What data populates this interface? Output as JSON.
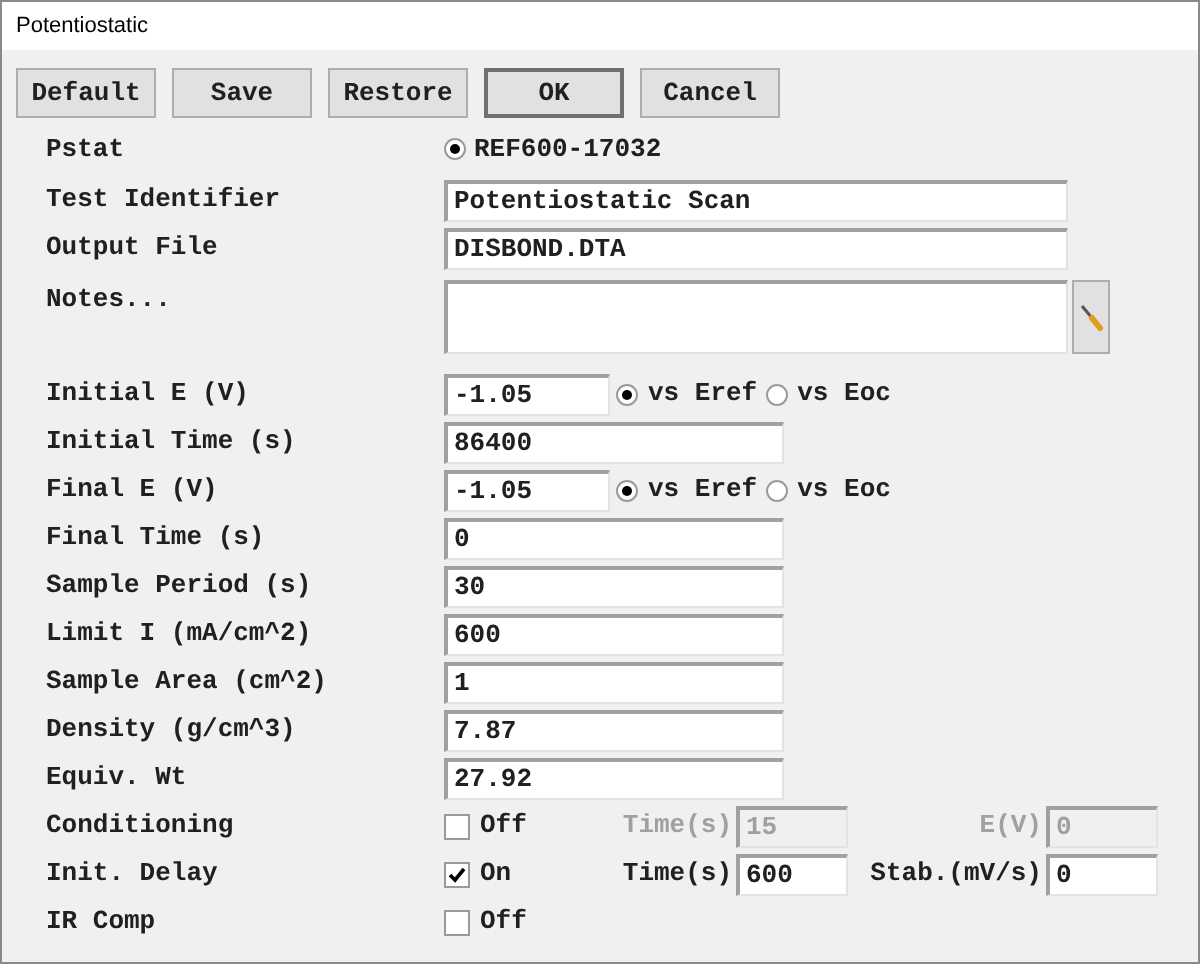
{
  "window": {
    "title": "Potentiostatic"
  },
  "buttons": [
    {
      "label": "Default",
      "default": false
    },
    {
      "label": "Save",
      "default": false
    },
    {
      "label": "Restore",
      "default": false
    },
    {
      "label": "OK",
      "default": true
    },
    {
      "label": "Cancel",
      "default": false
    }
  ],
  "rows": [
    {
      "kind": "radio",
      "label": "Pstat",
      "option": "REF600-17032",
      "selected": true
    },
    {
      "kind": "longtext",
      "label": "Test Identifier",
      "value": "Potentiostatic Scan"
    },
    {
      "kind": "longtext",
      "label": "Output File",
      "value": "DISBOND.DTA"
    },
    {
      "kind": "notes",
      "label": "Notes..."
    },
    {
      "kind": "potential",
      "label": "Initial E (V)",
      "value": "-1.05",
      "options": [
        {
          "label": "vs Eref",
          "selected": true
        },
        {
          "label": "vs Eoc",
          "selected": false
        }
      ]
    },
    {
      "kind": "text",
      "label": "Initial Time (s)",
      "value": "86400"
    },
    {
      "kind": "potential",
      "label": "Final E (V)",
      "value": "-1.05",
      "options": [
        {
          "label": "vs Eref",
          "selected": true
        },
        {
          "label": "vs Eoc",
          "selected": false
        }
      ]
    },
    {
      "kind": "text",
      "label": "Final Time (s)",
      "value": "0"
    },
    {
      "kind": "text",
      "label": "Sample Period (s)",
      "value": "30"
    },
    {
      "kind": "text",
      "label": "Limit I (mA/cm^2)",
      "value": "600"
    },
    {
      "kind": "text",
      "label": "Sample Area (cm^2)",
      "value": "1"
    },
    {
      "kind": "text",
      "label": "Density (g/cm^3)",
      "value": "7.87"
    },
    {
      "kind": "text",
      "label": "Equiv. Wt",
      "value": "27.92"
    },
    {
      "kind": "check",
      "label": "Conditioning",
      "checked": false,
      "state": "Off",
      "fields": [
        {
          "label": "Time(s)",
          "value": "15",
          "disabled": true
        },
        {
          "label": "E(V)",
          "value": "0",
          "disabled": true
        }
      ]
    },
    {
      "kind": "check",
      "label": "Init. Delay",
      "checked": true,
      "state": "On",
      "fields": [
        {
          "label": "Time(s)",
          "value": "600",
          "disabled": false
        },
        {
          "label": "Stab.(mV/s)",
          "value": "0",
          "disabled": false
        }
      ]
    },
    {
      "kind": "check",
      "label": "IR Comp",
      "checked": false,
      "state": "Off"
    }
  ]
}
